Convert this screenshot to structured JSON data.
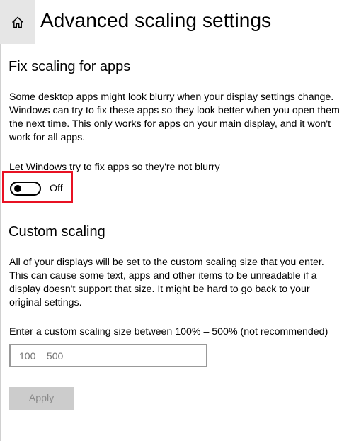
{
  "header": {
    "home_icon": "home-icon",
    "title": "Advanced scaling settings"
  },
  "fix_scaling": {
    "heading": "Fix scaling for apps",
    "description": "Some desktop apps might look blurry when your display settings change. Windows can try to fix these apps so they look better when you open them the next time. This only works for apps on your main display, and it won't work for all apps.",
    "toggle_label": "Let Windows try to fix apps so they're not blurry",
    "toggle_state": "Off",
    "toggle_on": false,
    "highlight_color": "#e81123"
  },
  "custom_scaling": {
    "heading": "Custom scaling",
    "description": "All of your displays will be set to the custom scaling size that you enter. This can cause some text, apps and other items to be unreadable if a display doesn't support that size. It might be hard to go back to your original settings.",
    "input_label": "Enter a custom scaling size between 100% – 500% (not recommended)",
    "input_value": "",
    "input_placeholder": "100 – 500",
    "apply_label": "Apply",
    "apply_enabled": false
  }
}
